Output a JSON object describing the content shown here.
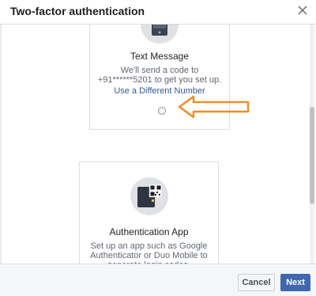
{
  "dialog": {
    "title": "Two-factor authentication",
    "close_icon": "close-icon"
  },
  "options": [
    {
      "icon": "phone-icon",
      "title": "Text Message",
      "description": "We'll send a code to +91******5201 to get you set up.",
      "link": "Use a Different Number",
      "selected": false
    },
    {
      "icon": "qr-phone-icon",
      "title": "Authentication App",
      "description": "Set up an app such as Google Authenticator or Duo Mobile to generate login codes."
    }
  ],
  "annotation": {
    "arrow_color": "#f28c28"
  },
  "footer": {
    "cancel_label": "Cancel",
    "next_label": "Next"
  },
  "colors": {
    "primary": "#4267b2",
    "link": "#385898"
  }
}
